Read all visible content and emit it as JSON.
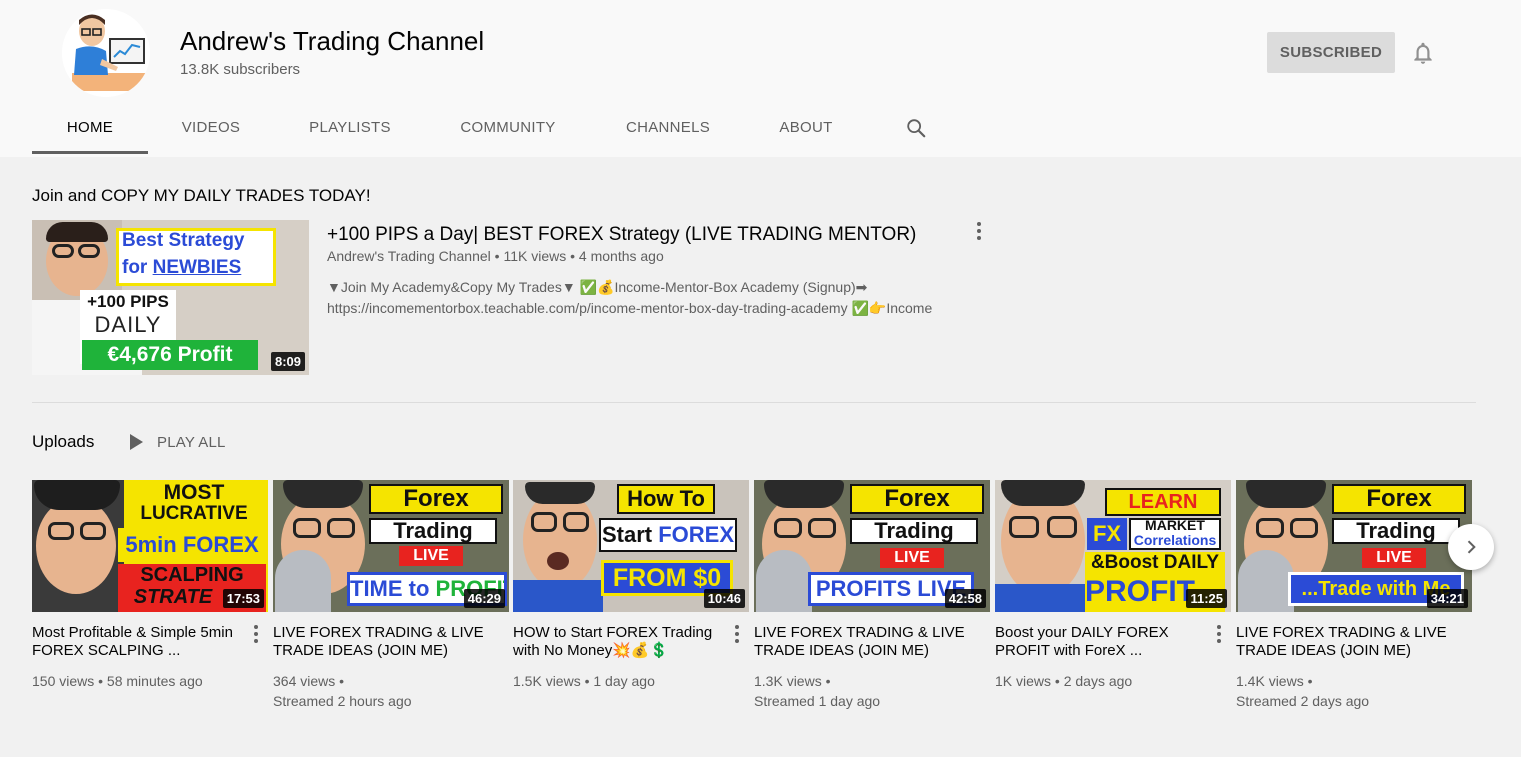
{
  "channel": {
    "name": "Andrew's Trading Channel",
    "subscribers": "13.8K subscribers",
    "subscribe_label": "SUBSCRIBED"
  },
  "tabs": [
    "HOME",
    "VIDEOS",
    "PLAYLISTS",
    "COMMUNITY",
    "CHANNELS",
    "ABOUT"
  ],
  "active_tab": "HOME",
  "featured": {
    "section_title": "Join and COPY MY DAILY TRADES TODAY!",
    "title": "+100 PIPS a Day| BEST FOREX Strategy (LIVE TRADING MENTOR)",
    "channel": "Andrew's Trading Channel",
    "meta": "• 11K views • 4 months ago",
    "desc_line1": "▼Join My Academy&Copy My Trades▼ ✅💰Income-Mentor-Box Academy (Signup)➡",
    "desc_line2": "https://incomementorbox.teachable.com/p/income-mentor-box-day-trading-academy ✅👉Income",
    "duration": "8:09",
    "thumb": {
      "line1": "Best Strategy",
      "line2a": "for ",
      "line2b": "NEWBIES",
      "line3": "+100 PIPS",
      "line4": "DAILY",
      "line5": "€4,676 Profit"
    }
  },
  "uploads": {
    "title": "Uploads",
    "play_all": "PLAY ALL",
    "videos": [
      {
        "title": "Most Profitable & Simple 5min FOREX SCALPING ...",
        "meta1": "150 views • 58 minutes ago",
        "meta2": "",
        "duration": "17:53",
        "thumb": [
          "MOST",
          "LUCRATIVE",
          "5min FOREX",
          "SCALPING",
          "STRATE"
        ]
      },
      {
        "title": "LIVE FOREX TRADING & LIVE TRADE IDEAS (JOIN ME)",
        "meta1": "364 views •",
        "meta2": "Streamed 2 hours ago",
        "duration": "46:29",
        "thumb": [
          "Forex",
          "Trading",
          "LIVE",
          "TIME to ",
          "PROFIT"
        ]
      },
      {
        "title": "HOW to Start FOREX Trading with No Money💥💰💲",
        "meta1": "1.5K views • 1 day ago",
        "meta2": "",
        "duration": "10:46",
        "thumb": [
          "How To",
          "Start ",
          "FOREX",
          "FROM $0"
        ]
      },
      {
        "title": "LIVE FOREX TRADING & LIVE TRADE IDEAS (JOIN ME)",
        "meta1": "1.3K views •",
        "meta2": "Streamed 1 day ago",
        "duration": "42:58",
        "thumb": [
          "Forex",
          "Trading",
          "LIVE",
          "PROFITS LIVE"
        ]
      },
      {
        "title": "Boost your DAILY FOREX PROFIT with ForeX ...",
        "meta1": "1K views • 2 days ago",
        "meta2": "",
        "duration": "11:25",
        "thumb": [
          "LEARN",
          "FX",
          "MARKET",
          "Correlations",
          "&Boost DAILY",
          "PROFITS"
        ]
      },
      {
        "title": "LIVE FOREX TRADING & LIVE TRADE IDEAS (JOIN ME)",
        "meta1": "1.4K views •",
        "meta2": "Streamed 2 days ago",
        "duration": "34:21",
        "thumb": [
          "Forex",
          "Trading",
          "LIVE",
          "...Trade with Me"
        ]
      }
    ]
  },
  "icons": {
    "bell": "bell-icon",
    "search": "search-icon",
    "more": "more-vert-icon",
    "play": "play-icon",
    "next": "chevron-right-icon"
  },
  "colors": {
    "thumb_yellow": "#f5e400",
    "thumb_blue": "#2b4bd6",
    "thumb_red": "#e8231f",
    "thumb_green": "#1fb33a"
  }
}
